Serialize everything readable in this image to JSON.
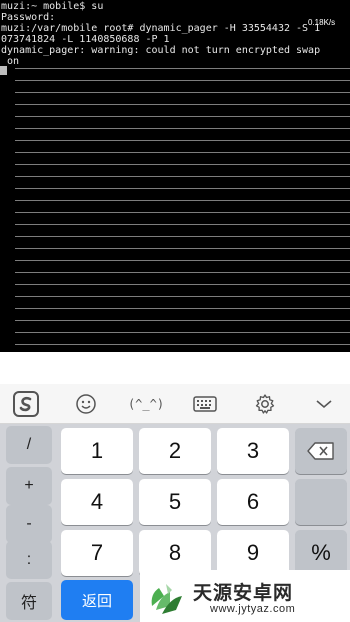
{
  "terminal": {
    "lines": [
      "muzi:~ mobile$ su",
      "Password:",
      "muzi:/var/mobile root# dynamic_pager -H 33554432 -S 1",
      "073741824 -L 1140850688 -P 1",
      "dynamic_pager: warning: could not turn encrypted swap",
      " on"
    ],
    "speed_indicator": "0.18K/s"
  },
  "toolbar": {
    "icons": [
      "sogou-logo-icon",
      "emoji-icon",
      "emoticon-icon",
      "keyboard-icon",
      "settings-icon",
      "collapse-chevron-icon"
    ],
    "emoticon_label": "(^_^)"
  },
  "keyboard": {
    "side_keys": [
      "/",
      "+",
      "-",
      ":",
      "符"
    ],
    "keys": [
      "1",
      "2",
      "3",
      "4",
      "5",
      "6",
      "7",
      "8",
      "9"
    ],
    "percent_key": "%",
    "return_key": "返回",
    "accent_color": "#1f7ef2"
  },
  "watermark": {
    "title": "天源安卓网",
    "url": "www.jytyaz.com"
  }
}
